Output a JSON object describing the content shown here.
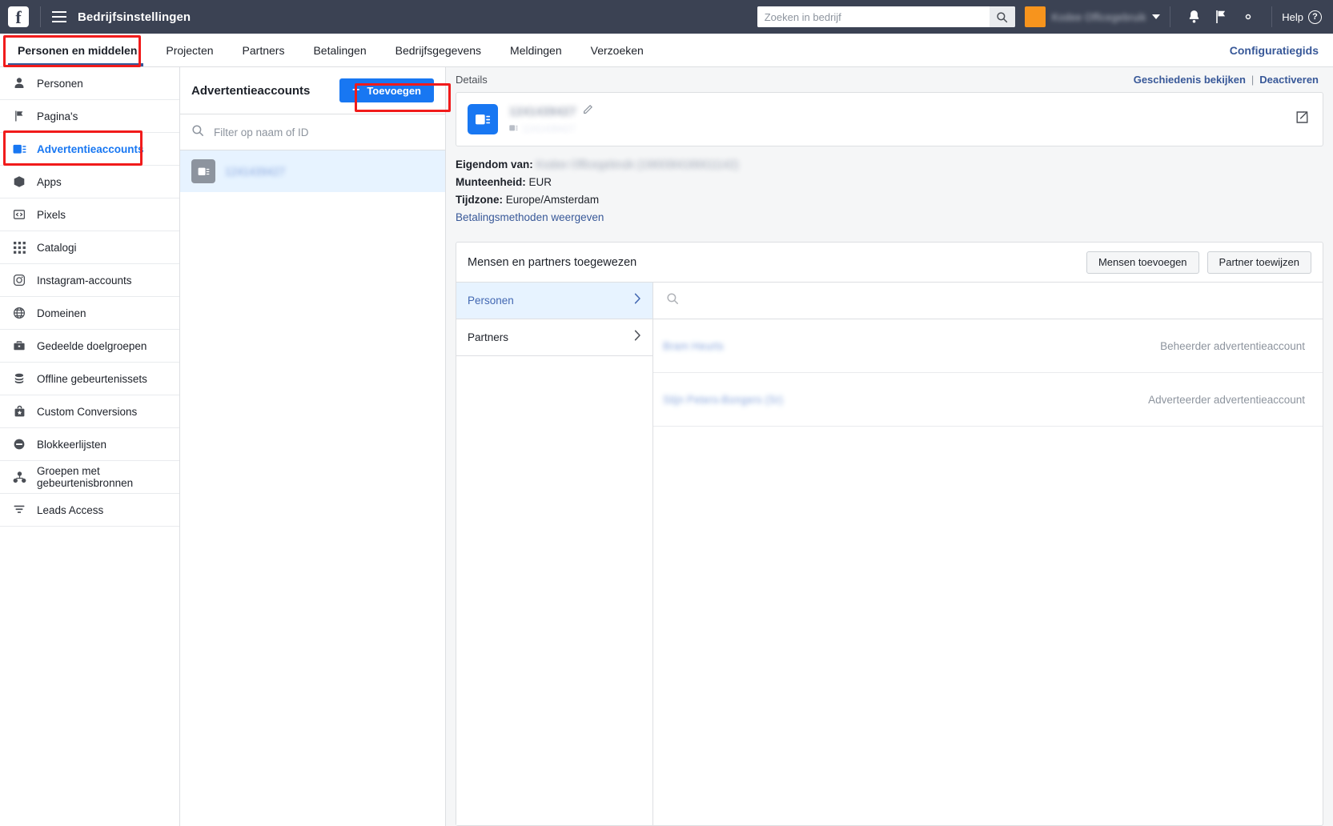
{
  "topbar": {
    "logo": "facebook-logo",
    "title": "Bedrijfsinstellingen",
    "search_placeholder": "Zoeken in bedrijf",
    "search_value": "",
    "business_name": "Kodee Officegebruik",
    "help_label": "Help",
    "icons": [
      "menu-icon",
      "search-icon",
      "notifications-icon",
      "flag-icon",
      "gear-icon",
      "help-icon"
    ]
  },
  "nav": {
    "tabs": [
      {
        "label": "Personen en middelen",
        "active": true
      },
      {
        "label": "Projecten",
        "active": false
      },
      {
        "label": "Partners",
        "active": false
      },
      {
        "label": "Betalingen",
        "active": false
      },
      {
        "label": "Bedrijfsgegevens",
        "active": false
      },
      {
        "label": "Meldingen",
        "active": false
      },
      {
        "label": "Verzoeken",
        "active": false
      }
    ],
    "config_link": "Configuratiegids"
  },
  "sidebar": {
    "items": [
      {
        "label": "Personen",
        "icon": "person-icon",
        "active": false
      },
      {
        "label": "Pagina's",
        "icon": "flag-icon",
        "active": false
      },
      {
        "label": "Advertentieaccounts",
        "icon": "ad-account-icon",
        "active": true
      },
      {
        "label": "Apps",
        "icon": "cube-icon",
        "active": false
      },
      {
        "label": "Pixels",
        "icon": "code-icon",
        "active": false
      },
      {
        "label": "Catalogi",
        "icon": "grid-icon",
        "active": false
      },
      {
        "label": "Instagram-accounts",
        "icon": "instagram-icon",
        "active": false
      },
      {
        "label": "Domeinen",
        "icon": "globe-icon",
        "active": false
      },
      {
        "label": "Gedeelde doelgroepen",
        "icon": "briefcase-icon",
        "active": false
      },
      {
        "label": "Offline gebeurtenissets",
        "icon": "database-icon",
        "active": false
      },
      {
        "label": "Custom Conversions",
        "icon": "bag-star-icon",
        "active": false
      },
      {
        "label": "Blokkeerlijsten",
        "icon": "block-icon",
        "active": false
      },
      {
        "label": "Groepen met gebeurtenisbronnen",
        "icon": "event-sources-icon",
        "active": false
      },
      {
        "label": "Leads Access",
        "icon": "funnel-icon",
        "active": false
      }
    ]
  },
  "list_panel": {
    "title": "Advertentieaccounts",
    "add_button": "Toevoegen",
    "filter_placeholder": "Filter op naam of ID",
    "filter_value": "",
    "accounts": [
      {
        "name": "1241439427",
        "selected": true,
        "icon": "ad-account-icon"
      }
    ]
  },
  "detail": {
    "header_label": "Details",
    "history_link": "Geschiedenis bekijken",
    "separator": "|",
    "deactivate_link": "Deactiveren",
    "account_name": "1241439427",
    "account_id": "1241439427",
    "edit_icon": "pencil-icon",
    "export_icon": "export-icon",
    "owner_label": "Eigendom van:",
    "owner_value": "Kodee Officegebruik (1969384186611142)",
    "currency_label": "Munteenheid:",
    "currency_value": "EUR",
    "timezone_label": "Tijdzone:",
    "timezone_value": "Europe/Amsterdam",
    "payment_link": "Betalingsmethoden weergeven"
  },
  "assigned": {
    "title": "Mensen en partners toegewezen",
    "add_people_button": "Mensen toevoegen",
    "assign_partner_button": "Partner toewijzen",
    "nav": [
      {
        "label": "Personen",
        "active": true
      },
      {
        "label": "Partners",
        "active": false
      }
    ],
    "search_placeholder": "",
    "search_value": "",
    "people": [
      {
        "name": "Bram Heurts",
        "role": "Beheerder advertentieaccount"
      },
      {
        "name": "Stijn Peters-Bongers (Sr)",
        "role": "Adverteerder advertentieaccount"
      }
    ]
  },
  "highlights": {
    "color": "#f11b1b",
    "regions": [
      "tab-personen-en-middelen",
      "sidebar-item-advertentieaccounts",
      "add-button"
    ]
  }
}
